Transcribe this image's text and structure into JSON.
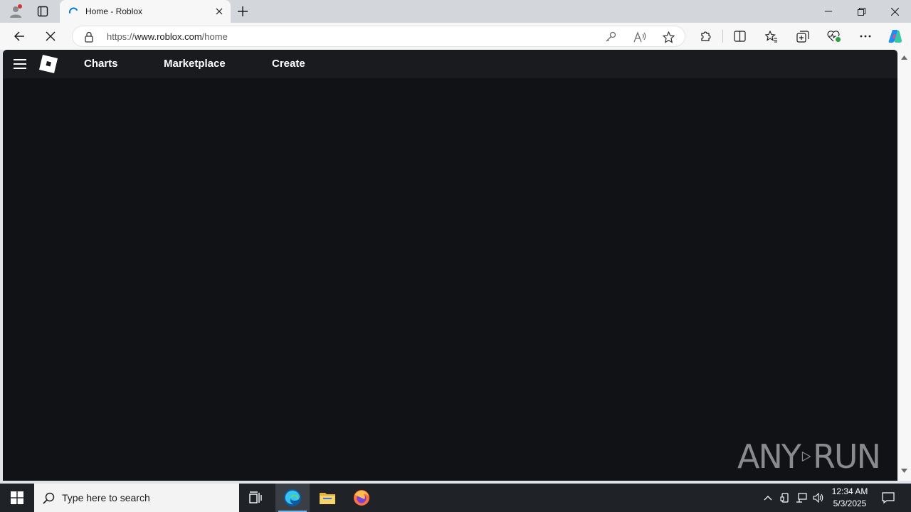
{
  "browser": {
    "tab": {
      "title": "Home - Roblox"
    },
    "address": {
      "scheme_prefix": "https://",
      "host": "www.roblox.com",
      "path": "/home"
    }
  },
  "page": {
    "nav": [
      "Charts",
      "Marketplace",
      "Create"
    ]
  },
  "watermark": {
    "left": "ANY",
    "right": "RUN"
  },
  "taskbar": {
    "search_placeholder": "Type here to search",
    "clock_time": "12:34 AM",
    "clock_date": "5/3/2025"
  },
  "colors": {
    "page_bg": "#111216",
    "header_bg": "#191b1f",
    "accent": "#0078d4"
  }
}
